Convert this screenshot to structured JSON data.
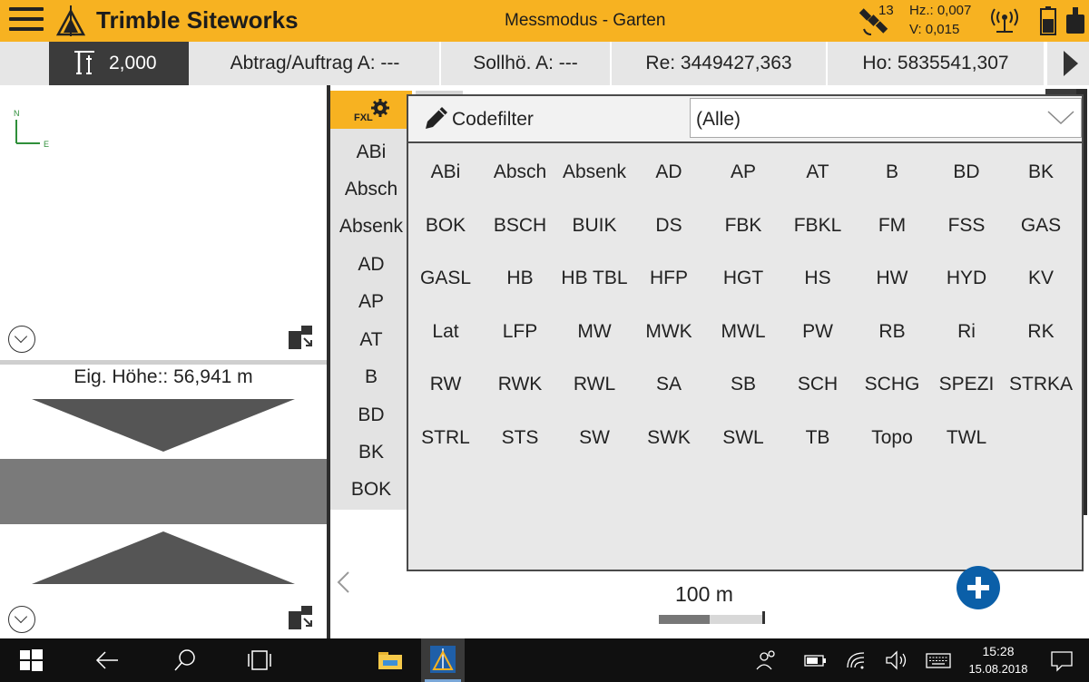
{
  "titlebar": {
    "app_title": "Trimble Siteworks",
    "mode_title": "Messmodus - Garten",
    "satellites": "13",
    "hz": "Hz.: 0,007",
    "v": "V: 0,015"
  },
  "infobar": {
    "rod_height": "2,000",
    "cut_fill": "Abtrag/Auftrag A: ---",
    "design_height": "Sollhö. A: ---",
    "easting": "Re: 3449427,363",
    "northing": "Ho: 5835541,307"
  },
  "left_pane": {
    "compass_n": "N",
    "compass_e": "E",
    "antenna_height": "Eig. Höhe:: 56,941 m"
  },
  "right_pane": {
    "fxl_tab_label": "FXL",
    "code_column": [
      "ABi",
      "Absch",
      "Absenk",
      "AD",
      "AP",
      "AT",
      "B",
      "BD",
      "BK",
      "BOK"
    ],
    "codefilter_label": "Codefilter",
    "filter_value": "(Alle)",
    "codes": [
      [
        "ABi",
        "Absch",
        "Absenk",
        "AD",
        "AP",
        "AT",
        "B",
        "BD",
        "BK"
      ],
      [
        "BOK",
        "BSCH",
        "BUIK",
        "DS",
        "FBK",
        "FBKL",
        "FM",
        "FSS",
        "GAS"
      ],
      [
        "GASL",
        "HB",
        "HB TBL",
        "HFP",
        "HGT",
        "HS",
        "HW",
        "HYD",
        "KV"
      ],
      [
        "Lat",
        "LFP",
        "MW",
        "MWK",
        "MWL",
        "PW",
        "RB",
        "Ri",
        "RK"
      ],
      [
        "RW",
        "RWK",
        "RWL",
        "SA",
        "SB",
        "SCH",
        "SCHG",
        "SPEZI",
        "STRKA"
      ],
      [
        "STRL",
        "STS",
        "SW",
        "SWK",
        "SWL",
        "TB",
        "Topo",
        "TWL"
      ]
    ],
    "scale_label": "100 m"
  },
  "taskbar": {
    "time": "15:28",
    "date": "15.08.2018"
  },
  "colors": {
    "accent": "#f7b221",
    "add_button": "#0b5fa8",
    "taskbar": "#101010"
  }
}
